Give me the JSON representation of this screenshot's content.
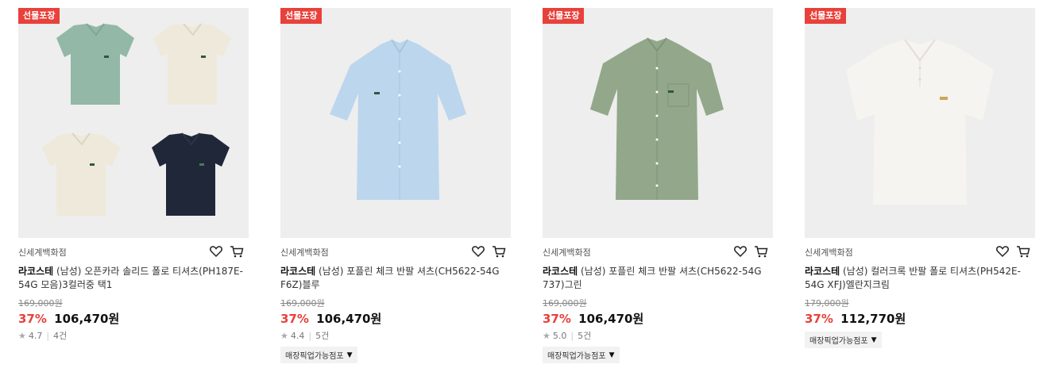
{
  "products": [
    {
      "badge": "선물포장",
      "store": "신세계백화점",
      "brand": "라코스테",
      "name": "(남성) 오픈카라 솔리드 폴로 티셔츠(PH187E-54G 모음)3컬러중 택1",
      "original_price": "169,000원",
      "discount": "37%",
      "price": "106,470원",
      "rating": "4.7",
      "reviews": "4건",
      "pickup": ""
    },
    {
      "badge": "선물포장",
      "store": "신세계백화점",
      "brand": "라코스테",
      "name": "(남성) 포플린 체크 반팔 셔츠(CH5622-54G F6Z)블루",
      "original_price": "169,000원",
      "discount": "37%",
      "price": "106,470원",
      "rating": "4.4",
      "reviews": "5건",
      "pickup": "매장픽업가능점포"
    },
    {
      "badge": "선물포장",
      "store": "신세계백화점",
      "brand": "라코스테",
      "name": "(남성) 포플린 체크 반팔 셔츠(CH5622-54G 737)그린",
      "original_price": "169,000원",
      "discount": "37%",
      "price": "106,470원",
      "rating": "5.0",
      "reviews": "5건",
      "pickup": "매장픽업가능점포"
    },
    {
      "badge": "선물포장",
      "store": "신세계백화점",
      "brand": "라코스테",
      "name": "(남성) 컬러크록 반팔 폴로 티셔츠(PH542E-54G XFJ)엘란지크림",
      "original_price": "179,000원",
      "discount": "37%",
      "price": "112,770원",
      "rating": "",
      "reviews": "",
      "pickup": "매장픽업가능점포"
    }
  ],
  "icons": {
    "wishlist": "heart-icon",
    "cart": "cart-icon",
    "star": "star-icon",
    "dropdown": "triangle-down-icon"
  },
  "colors": {
    "accent": "#e8403a",
    "mint_shirt": "#94b8a8",
    "cream_shirt": "#efe9dc",
    "navy_shirt": "#1f2738",
    "blue_shirt": "#bcd6ee",
    "green_shirt": "#93a88b",
    "white_shirt": "#f2f0ec"
  }
}
